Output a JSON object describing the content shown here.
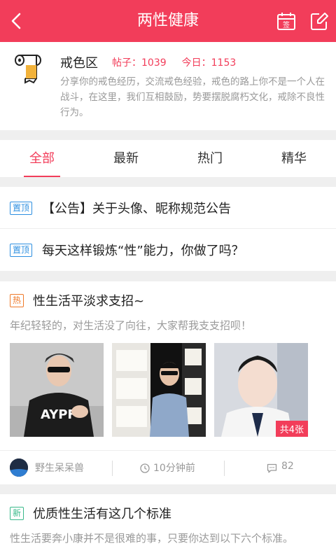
{
  "header": {
    "title": "两性健康",
    "calendar_badge": "签"
  },
  "forum": {
    "name": "戒色区",
    "posts_label": "帖子：1039",
    "today_label": "今日：1153",
    "description": "分享你的戒色经历，交流戒色经验，戒色的路上你不是一个人在战斗，在这里，我们互相鼓励，势要摆脱腐朽文化，戒除不良性行为。"
  },
  "tabs": [
    {
      "label": "全部",
      "active": true
    },
    {
      "label": "最新",
      "active": false
    },
    {
      "label": "热门",
      "active": false
    },
    {
      "label": "精华",
      "active": false
    }
  ],
  "pinned": [
    {
      "badge": "置顶",
      "title": "【公告】关于头像、昵称规范公告"
    },
    {
      "badge": "置顶",
      "title": "每天这样锻炼“性”能力，你做了吗？"
    }
  ],
  "posts": [
    {
      "badge": "热",
      "title": "性生活平淡求支招~",
      "summary": "年纪轻轻的，对生活没了向往，大家帮我支支招呗！",
      "image_count_label": "共4张",
      "author": "野生呆呆兽",
      "time": "10分钟前",
      "comments": "82"
    },
    {
      "badge": "新",
      "title": "优质性生活有这几个标准",
      "summary": "性生活要奔小康并不是很难的事，只要你达到以下六个标准。"
    }
  ],
  "colors": {
    "accent": "#f23d5a",
    "pin": "#2d8fe0",
    "hot": "#ef7a2a",
    "new": "#3ab98a"
  },
  "icons": [
    "back-arrow-icon",
    "calendar-icon",
    "edit-icon",
    "tissue-roll-icon",
    "clock-icon",
    "comment-icon"
  ]
}
